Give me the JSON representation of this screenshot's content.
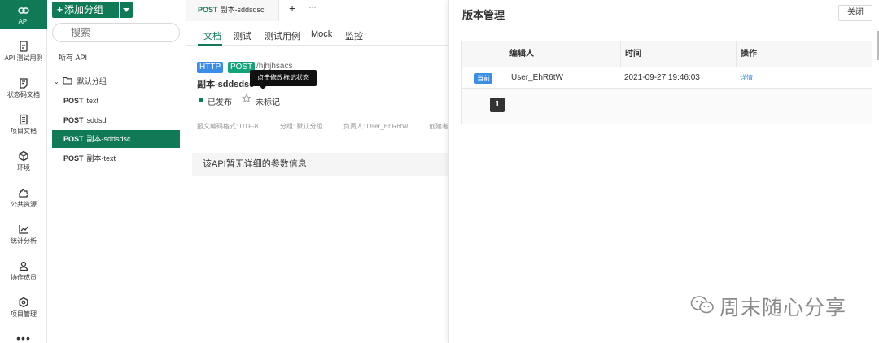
{
  "nav": {
    "items": [
      {
        "label": "API",
        "icon": "link-icon",
        "active": true
      },
      {
        "label": "API 测试用例",
        "icon": "test-case-icon"
      },
      {
        "label": "状态码文档",
        "icon": "status-doc-icon"
      },
      {
        "label": "项目文档",
        "icon": "project-doc-icon"
      },
      {
        "label": "环境",
        "icon": "environment-icon"
      },
      {
        "label": "公共资源",
        "icon": "puzzle-icon"
      },
      {
        "label": "统计分析",
        "icon": "chart-icon"
      },
      {
        "label": "协作成员",
        "icon": "members-icon"
      },
      {
        "label": "项目管理",
        "icon": "settings-icon"
      }
    ],
    "more": "•••"
  },
  "tree": {
    "add_label": "添加分组",
    "search_placeholder": "搜索",
    "all_api": "所有 API",
    "group_name": "默认分组",
    "items": [
      {
        "method": "POST",
        "name": "text"
      },
      {
        "method": "POST",
        "name": "sddsd"
      },
      {
        "method": "POST",
        "name": "副本-sddsdsc"
      },
      {
        "method": "POST",
        "name": "副本-text"
      }
    ]
  },
  "main": {
    "tab": {
      "method": "POST",
      "name": "副本-sddsdsc"
    },
    "tab_add": "+",
    "tab_more": "···",
    "subtabs": [
      "文档",
      "测试",
      "测试用例",
      "Mock",
      "监控"
    ],
    "protocol": "HTTP",
    "method": "POST",
    "path": "/hjhjhsacs",
    "api_name": "副本-sddsdsc",
    "tooltip": "点击修改标记状态",
    "status": "已发布",
    "mark": "未标记",
    "meta": {
      "encoding": "报文编码格式: UTF-8",
      "group": "分组: 默认分组",
      "owner": "负责人: User_EhR6tW",
      "creator": "创建者"
    },
    "no_params": "该API暂无详细的参数信息"
  },
  "version_panel": {
    "title": "版本管理",
    "close_label": "关闭",
    "columns": [
      "",
      "编辑人",
      "时间",
      "操作"
    ],
    "rows": [
      {
        "badge": "当前",
        "editor": "User_EhR6tW",
        "time": "2021-09-27 19:46:03",
        "action": "详情"
      }
    ],
    "page": "1"
  },
  "watermark": {
    "text": "周末随心分享"
  },
  "colors": {
    "primary": "#0f7a55",
    "link": "#3b8ee8",
    "post": "#13a37a"
  }
}
